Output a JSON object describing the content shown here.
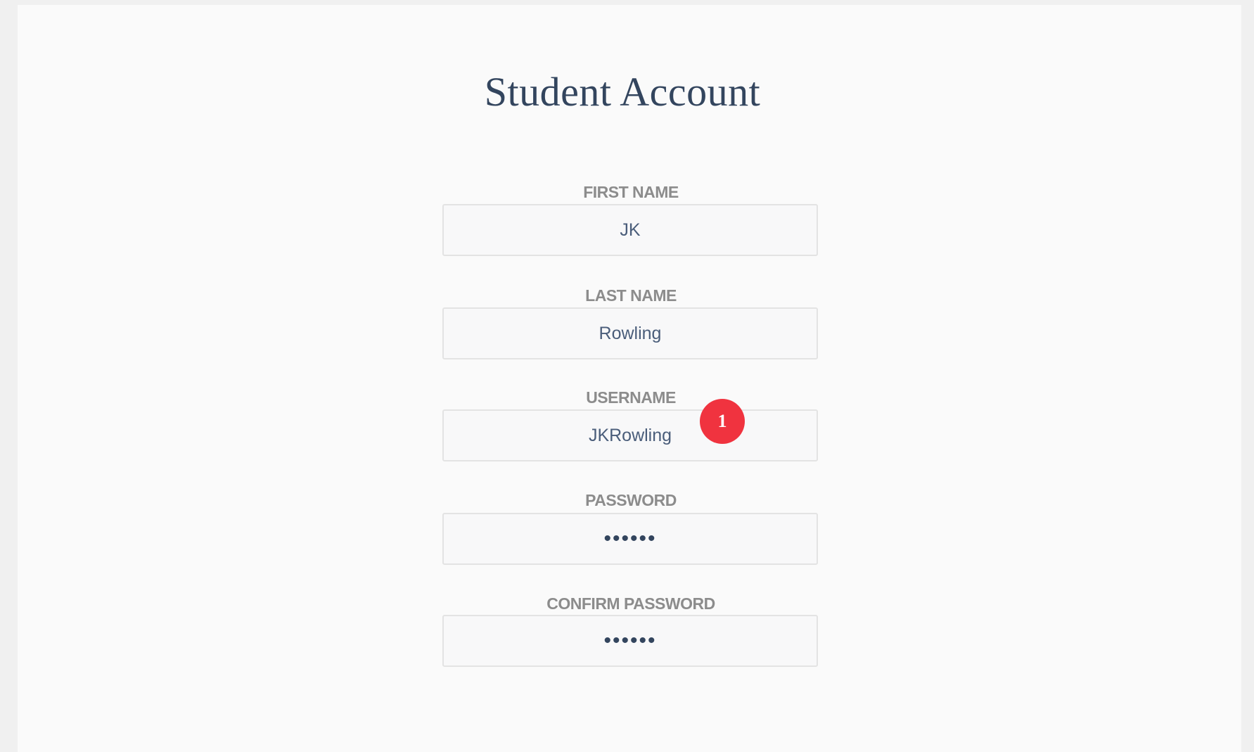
{
  "page": {
    "title": "Student Account"
  },
  "form": {
    "first_name": {
      "label": "FIRST NAME",
      "value": "JK"
    },
    "last_name": {
      "label": "LAST NAME",
      "value": "Rowling"
    },
    "username": {
      "label": "USERNAME",
      "value": "JKRowling"
    },
    "password": {
      "label": "PASSWORD",
      "value": "••••••"
    },
    "confirm_password": {
      "label": "CONFIRM PASSWORD",
      "value": "••••••"
    }
  },
  "annotation": {
    "badge_number": "1",
    "badge_color": "#f0333f"
  },
  "colors": {
    "title": "#33455e",
    "label": "#8c8c8c",
    "input_text": "#4a5d7a",
    "background": "#fafafa"
  }
}
